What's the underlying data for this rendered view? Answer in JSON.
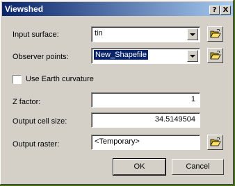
{
  "window": {
    "title": "Viewshed",
    "help_label": "?",
    "close_label": "X"
  },
  "form": {
    "input_surface": {
      "label": "Input surface:",
      "value": "tin"
    },
    "observer_points": {
      "label": "Observer points:",
      "value": "New_Shapefile"
    },
    "earth_curvature": {
      "label": "Use Earth curvature",
      "checked": false
    },
    "z_factor": {
      "label": "Z factor:",
      "value": "1"
    },
    "cell_size": {
      "label": "Output cell size:",
      "value": "34.5149504"
    },
    "output_raster": {
      "label": "Output raster:",
      "value": "<Temporary>"
    }
  },
  "buttons": {
    "ok": "OK",
    "cancel": "Cancel"
  },
  "colors": {
    "title_bar": "#0a246a",
    "face": "#d4d0c8",
    "background": "#4a6f24"
  }
}
